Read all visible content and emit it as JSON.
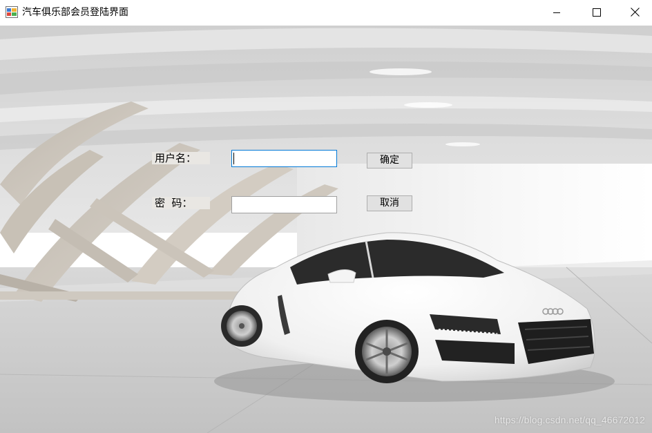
{
  "window": {
    "title": "汽车俱乐部会员登陆界面"
  },
  "icons": {
    "app": "app-icon",
    "minimize": "minimize-icon",
    "maximize": "maximize-icon",
    "close": "close-icon"
  },
  "form": {
    "username_label": "用户名：",
    "password_label": "密  码：",
    "username_value": "",
    "password_value": "",
    "ok_label": "确定",
    "cancel_label": "取消"
  },
  "watermark": "https://blog.csdn.net/qq_46672012",
  "colors": {
    "accent_focus": "#0078d7",
    "button_face": "#e1e1e1",
    "label_bg": "#e9e7e3"
  }
}
